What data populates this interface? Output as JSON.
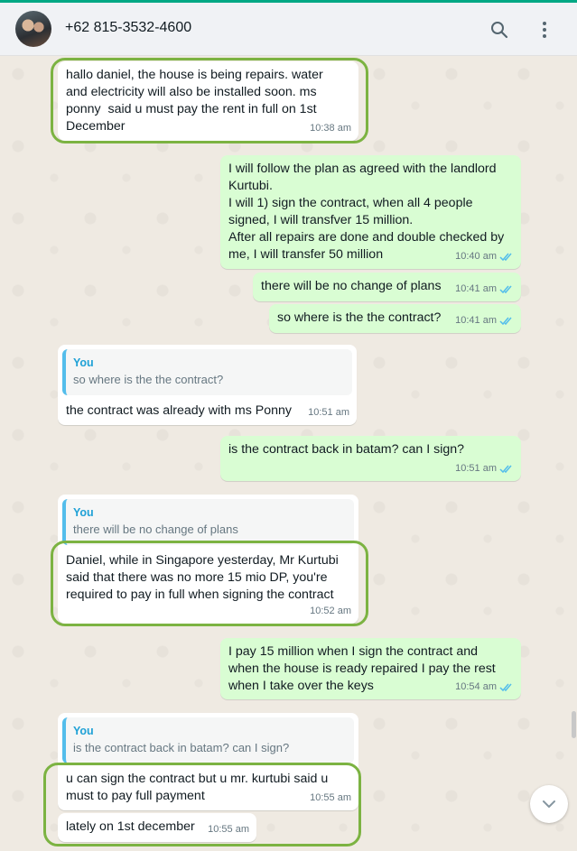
{
  "header": {
    "contact_name": "+62 815-3532-4600",
    "icons": [
      "search-icon",
      "menu-icon"
    ]
  },
  "colors": {
    "incoming_bubble": "#ffffff",
    "outgoing_bubble": "#d9fdd3",
    "read_ticks": "#53bdeb",
    "highlight": "#7cb342"
  },
  "messages": [
    {
      "direction": "in",
      "text": "hallo daniel, the house is being repairs. water\nand electricity will also be installed soon. ms\nponny  said u must pay the rent in full on 1st\nDecember",
      "time": "10:38 am"
    },
    {
      "direction": "out",
      "text": "I will follow the plan as agreed with the landlord\nKurtubi.\nI will 1) sign the contract, when all 4 people\nsigned, I will transfver 15 million.\nAfter all repairs are done and double checked by\nme, I will transfer 50 million",
      "time": "10:40 am"
    },
    {
      "direction": "out",
      "text": "there will be no change of plans",
      "time": "10:41 am"
    },
    {
      "direction": "out",
      "text": "so where is the the contract?",
      "time": "10:41 am"
    },
    {
      "direction": "in",
      "quote": {
        "author": "You",
        "text": "so where is the the contract?"
      },
      "text": "the contract was already with ms Ponny",
      "time": "10:51 am"
    },
    {
      "direction": "out",
      "text": "is the contract back in batam? can I sign?",
      "time": "10:51 am"
    },
    {
      "direction": "in",
      "quote": {
        "author": "You",
        "text": "there will be no change of plans"
      },
      "text": "Daniel, while in Singapore yesterday, Mr Kurtubi\nsaid that there was no more 15 mio DP, you're\nrequired to pay in full when signing the contract",
      "time": "10:52 am"
    },
    {
      "direction": "out",
      "text": "I pay 15 million when I sign the contract and\nwhen the house is ready repaired I pay the rest\nwhen I take over the keys",
      "time": "10:54 am"
    },
    {
      "direction": "in",
      "quote": {
        "author": "You",
        "text": "is the contract back in batam? can I sign?"
      },
      "text": "u can sign the contract but u mr. kurtubi said u\nmust to pay full payment",
      "time": "10:55 am"
    },
    {
      "direction": "in",
      "text": "lately on 1st december",
      "time": "10:55 am"
    }
  ]
}
